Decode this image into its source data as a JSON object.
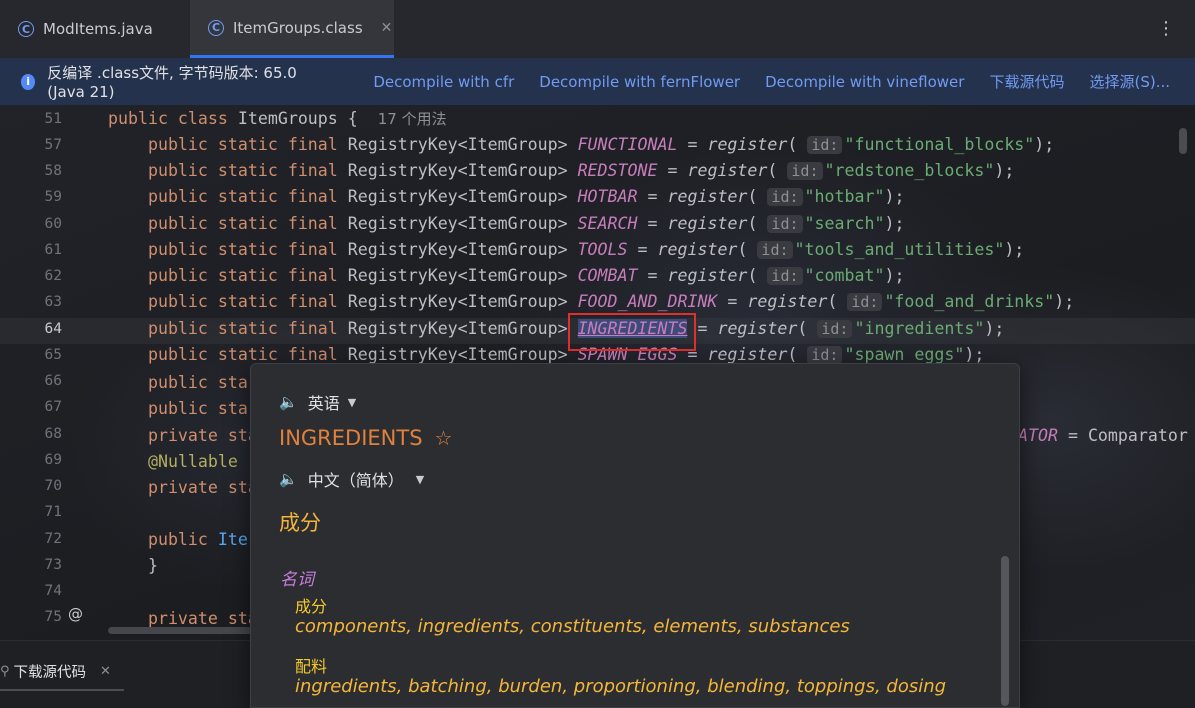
{
  "tabs": [
    {
      "label": "ModItems.java",
      "icon": "class-icon"
    },
    {
      "label": "ItemGroups.class",
      "icon": "class-icon",
      "active": true
    }
  ],
  "banner": {
    "text": "反编译 .class文件, 字节码版本: 65.0 (Java 21)",
    "links": [
      "Decompile with cfr",
      "Decompile with fernFlower",
      "Decompile with vineflower",
      "下载源代码",
      "选择源(S)..."
    ]
  },
  "editor": {
    "line_numbers": [
      "51",
      "57",
      "58",
      "59",
      "60",
      "61",
      "62",
      "63",
      "64",
      "65",
      "66",
      "67",
      "68",
      "69",
      "70",
      "71",
      "72",
      "73",
      "74",
      "75"
    ],
    "current_line": "64",
    "class_header": "public class ItemGroups {",
    "usage_hint": "17 个用法",
    "hint_id": "id:",
    "registry_type": "RegistryKey<ItemGroup>",
    "fields": [
      {
        "name": "FUNCTIONAL",
        "id": "\"functional_blocks\""
      },
      {
        "name": "REDSTONE",
        "id": "\"redstone_blocks\""
      },
      {
        "name": "HOTBAR",
        "id": "\"hotbar\""
      },
      {
        "name": "SEARCH",
        "id": "\"search\""
      },
      {
        "name": "TOOLS",
        "id": "\"tools_and_utilities\""
      },
      {
        "name": "COMBAT",
        "id": "\"combat\""
      },
      {
        "name": "FOOD_AND_DRINK",
        "id": "\"food_and_drinks\""
      },
      {
        "name": "INGREDIENTS",
        "id": "\"ingredients\""
      },
      {
        "name": "SPAWN_EGGS",
        "id": "\"spawn_eggs\""
      }
    ],
    "partial_lines": {
      "l66": "public sta",
      "l67": "public sta",
      "l68": "private sta",
      "l68_tail": "ATOR",
      "l68_rest": " = Comparator",
      "l69": "@Nullable",
      "l70": "private sta",
      "l72_kw": "public",
      "l72_ty": " Ite",
      "l73": "}",
      "l75": "private sta"
    }
  },
  "bottom": {
    "tab_label": "下载源代码"
  },
  "popup": {
    "source_lang": "英语",
    "word": "INGREDIENTS",
    "target_lang": "中文（简体）",
    "translation": "成分",
    "pos": "名词",
    "senses": [
      {
        "meaning": "成分",
        "synonyms": "components, ingredients, constituents, elements, substances"
      },
      {
        "meaning": "配料",
        "synonyms": "ingredients, batching, burden, proportioning, blending, toppings, dosing"
      }
    ]
  },
  "colors": {
    "accent": "#3574f0",
    "keyword": "#cf8e6d",
    "field": "#c77dbb",
    "string": "#6aab73",
    "word_orange": "#e0823d",
    "highlight_red": "#e0302e"
  }
}
